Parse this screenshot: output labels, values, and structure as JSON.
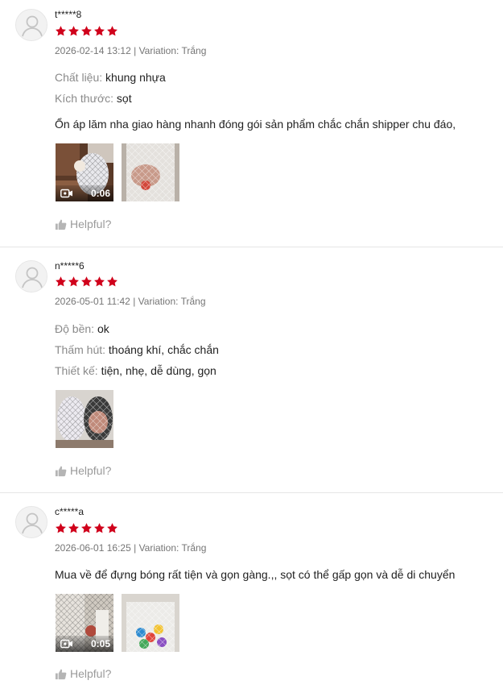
{
  "colors": {
    "star": "#d0011b",
    "muted": "#757575",
    "divider": "#e5e5e5"
  },
  "reviews": [
    {
      "username": "t*****8",
      "rating": 5,
      "datetime": "2026-02-14 13:12",
      "separator": "|",
      "variation_label": "Variation:",
      "variation_value": "Trắng",
      "attributes": [
        {
          "key": "Chất liệu:",
          "value": "khung nhựa"
        },
        {
          "key": "Kích thước:",
          "value": "sọt"
        }
      ],
      "comment": "Ổn áp lăm nha giao hàng nhanh đóng gói sản phẩm chắc chắn shipper chu đáo,",
      "media": [
        {
          "type": "video",
          "duration": "0:06",
          "icon": "video-camera-icon"
        },
        {
          "type": "image"
        }
      ],
      "helpful_label": "Helpful?"
    },
    {
      "username": "n*****6",
      "rating": 5,
      "datetime": "2026-05-01 11:42",
      "separator": "|",
      "variation_label": "Variation:",
      "variation_value": "Trắng",
      "attributes": [
        {
          "key": "Độ bền:",
          "value": "ok"
        },
        {
          "key": "Thấm hút:",
          "value": "thoáng khí, chắc chắn"
        },
        {
          "key": "Thiết kế:",
          "value": "tiện, nhẹ, dễ dùng, gọn"
        }
      ],
      "comment": "",
      "media": [
        {
          "type": "image"
        }
      ],
      "helpful_label": "Helpful?"
    },
    {
      "username": "c*****a",
      "rating": 5,
      "datetime": "2026-06-01 16:25",
      "separator": "|",
      "variation_label": "Variation:",
      "variation_value": "Trắng",
      "attributes": [],
      "comment": "Mua về để đựng bóng rất tiện và gọn gàng.,, sọt có thể gấp gọn và dễ di chuyển",
      "media": [
        {
          "type": "video",
          "duration": "0:05",
          "icon": "video-camera-icon"
        },
        {
          "type": "image"
        }
      ],
      "helpful_label": "Helpful?"
    }
  ]
}
